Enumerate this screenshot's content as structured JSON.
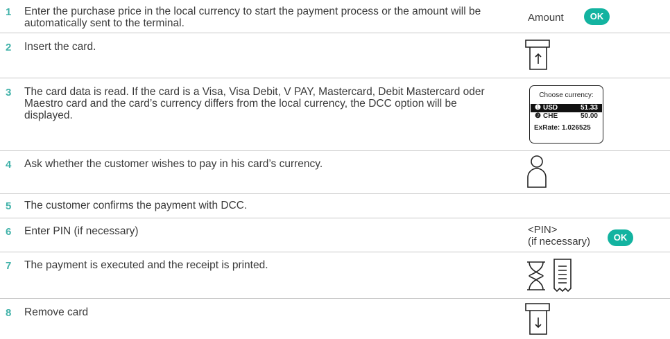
{
  "steps": [
    {
      "num": "1",
      "text": "Enter the purchase price in the local currency to start the payment process or the amount will be automatically sent to the terminal."
    },
    {
      "num": "2",
      "text": "Insert the card."
    },
    {
      "num": "3",
      "text": "The card data is read. If the card is a Visa, Visa Debit, V PAY, Mastercard, Debit Mastercard oder Maestro card and the card’s currency differs from the local currency, the DCC option will be displayed."
    },
    {
      "num": "4",
      "text": "Ask whether the customer wishes to pay in his card’s currency."
    },
    {
      "num": "5",
      "text": "The customer confirms the payment with DCC."
    },
    {
      "num": "6",
      "text": "Enter PIN (if necessary)"
    },
    {
      "num": "7",
      "text": "The payment is executed and the receipt is printed."
    },
    {
      "num": "8",
      "text": "Remove card"
    }
  ],
  "actions": {
    "amount_label": "Amount",
    "ok_label": "OK",
    "pin_label": "<PIN>",
    "pin_note": "(if necessary)"
  },
  "terminal_screen": {
    "header": "Choose currency:",
    "options": [
      {
        "bullet": "❶",
        "currency": "USD",
        "amount": "51.33"
      },
      {
        "bullet": "❷",
        "currency": "CHE",
        "amount": "50.00"
      }
    ],
    "exrate": "ExRate: 1.026525"
  },
  "icons": [
    "card-insert-icon",
    "person-icon",
    "hourglass-icon",
    "receipt-icon",
    "card-remove-icon"
  ],
  "colors": {
    "accent": "#13b3a0",
    "step_number": "#3fb1a8",
    "divider": "#c8c8c8"
  }
}
